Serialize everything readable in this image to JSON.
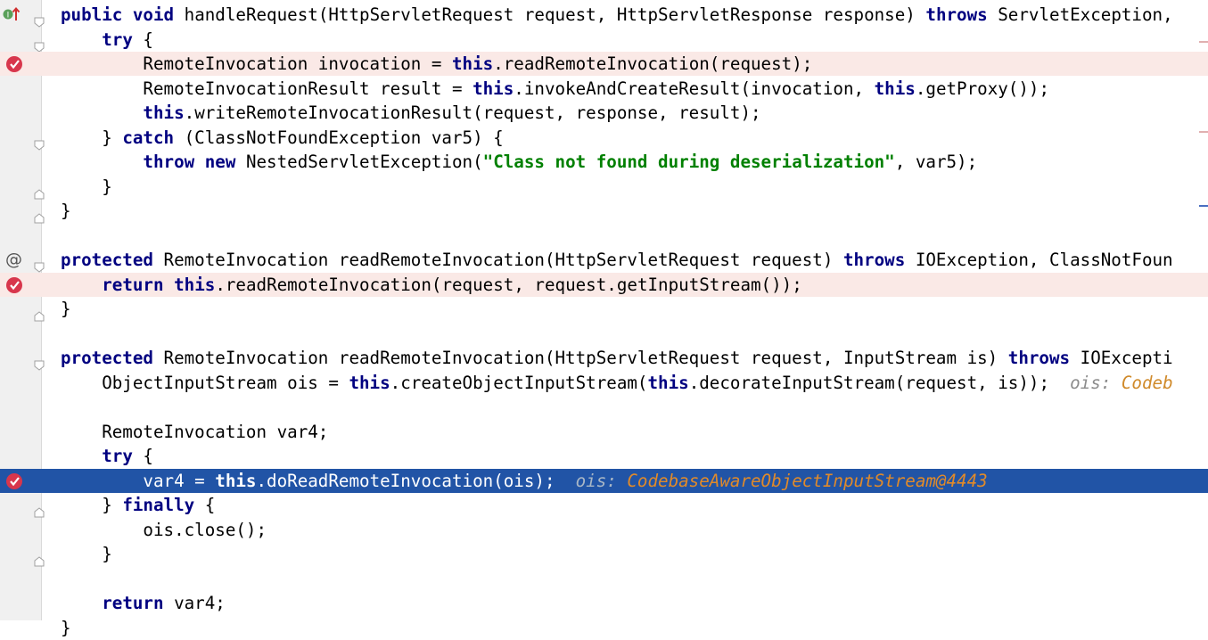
{
  "editor": {
    "language": "java",
    "lines": [
      [
        {
          "t": "public",
          "k": "kw"
        },
        {
          "t": " "
        },
        {
          "t": "void",
          "k": "kw"
        },
        {
          "t": " handleRequest(HttpServletRequest request, HttpServletResponse response) "
        },
        {
          "t": "throws",
          "k": "kw"
        },
        {
          "t": " ServletException,"
        }
      ],
      [
        {
          "t": "    "
        },
        {
          "t": "try",
          "k": "kw"
        },
        {
          "t": " {"
        }
      ],
      [
        {
          "t": "        RemoteInvocation invocation = "
        },
        {
          "t": "this",
          "k": "kw"
        },
        {
          "t": ".readRemoteInvocation(request);"
        }
      ],
      [
        {
          "t": "        RemoteInvocationResult result = "
        },
        {
          "t": "this",
          "k": "kw"
        },
        {
          "t": ".invokeAndCreateResult(invocation, "
        },
        {
          "t": "this",
          "k": "kw"
        },
        {
          "t": ".getProxy());"
        }
      ],
      [
        {
          "t": "        "
        },
        {
          "t": "this",
          "k": "kw"
        },
        {
          "t": ".writeRemoteInvocationResult(request, response, result);"
        }
      ],
      [
        {
          "t": "    } "
        },
        {
          "t": "catch",
          "k": "kw"
        },
        {
          "t": " (ClassNotFoundException var5) {"
        }
      ],
      [
        {
          "t": "        "
        },
        {
          "t": "throw",
          "k": "kw"
        },
        {
          "t": " "
        },
        {
          "t": "new",
          "k": "kw"
        },
        {
          "t": " NestedServletException("
        },
        {
          "t": "\"Class not found during deserialization\"",
          "k": "str"
        },
        {
          "t": ", var5);"
        }
      ],
      [
        {
          "t": "    }"
        }
      ],
      [
        {
          "t": "}"
        }
      ],
      [],
      [
        {
          "t": "protected",
          "k": "kw"
        },
        {
          "t": " RemoteInvocation readRemoteInvocation(HttpServletRequest request) "
        },
        {
          "t": "throws",
          "k": "kw"
        },
        {
          "t": " IOException, ClassNotFoun"
        }
      ],
      [
        {
          "t": "    "
        },
        {
          "t": "return",
          "k": "kw"
        },
        {
          "t": " "
        },
        {
          "t": "this",
          "k": "kw"
        },
        {
          "t": ".readRemoteInvocation(request, request.getInputStream());"
        }
      ],
      [
        {
          "t": "}"
        }
      ],
      [],
      [
        {
          "t": "protected",
          "k": "kw"
        },
        {
          "t": " RemoteInvocation readRemoteInvocation(HttpServletRequest request, InputStream is) "
        },
        {
          "t": "throws",
          "k": "kw"
        },
        {
          "t": " IOExcepti"
        }
      ],
      [
        {
          "t": "    ObjectInputStream ois = "
        },
        {
          "t": "this",
          "k": "kw"
        },
        {
          "t": ".createObjectInputStream("
        },
        {
          "t": "this",
          "k": "kw"
        },
        {
          "t": ".decorateInputStream(request, is));  "
        },
        {
          "t": "ois: ",
          "k": "inl"
        },
        {
          "t": "Codeb",
          "k": "inlv"
        }
      ],
      [],
      [
        {
          "t": "    RemoteInvocation var4;"
        }
      ],
      [
        {
          "t": "    "
        },
        {
          "t": "try",
          "k": "kw"
        },
        {
          "t": " {"
        }
      ],
      [
        {
          "t": "        var4 = "
        },
        {
          "t": "this",
          "k": "kw"
        },
        {
          "t": ".doReadRemoteInvocation(ois);  "
        },
        {
          "t": "ois: ",
          "k": "inl"
        },
        {
          "t": "CodebaseAwareObjectInputStream@4443",
          "k": "inlv"
        }
      ],
      [
        {
          "t": "    } "
        },
        {
          "t": "finally",
          "k": "kw"
        },
        {
          "t": " {"
        }
      ],
      [
        {
          "t": "        ois.close();"
        }
      ],
      [
        {
          "t": "    }"
        }
      ],
      [],
      [
        {
          "t": "    "
        },
        {
          "t": "return",
          "k": "kw"
        },
        {
          "t": " var4;"
        }
      ],
      [
        {
          "t": "}"
        }
      ]
    ],
    "breakpoint_lines": [
      2,
      11,
      19
    ],
    "current_execution_line": 19,
    "annotation_lines": [
      10
    ],
    "annotation_symbol": "@",
    "override_lines": [
      0
    ],
    "fold_open_lines": [
      0,
      1,
      5,
      10,
      14
    ],
    "fold_close_lines": [
      7,
      8,
      12,
      20,
      22
    ],
    "colors": {
      "keyword": "#000080",
      "string": "#008000",
      "breakpoint_line_bg": "#fae9e6",
      "execution_line_bg": "#2154a6",
      "inline_value": "#d08a2a",
      "gutter_bg": "#f0f0f0"
    },
    "icons": {
      "breakpoint": "breakpoint-icon",
      "override": "override-up-arrow-icon",
      "fold": "fold-marker-icon"
    }
  }
}
